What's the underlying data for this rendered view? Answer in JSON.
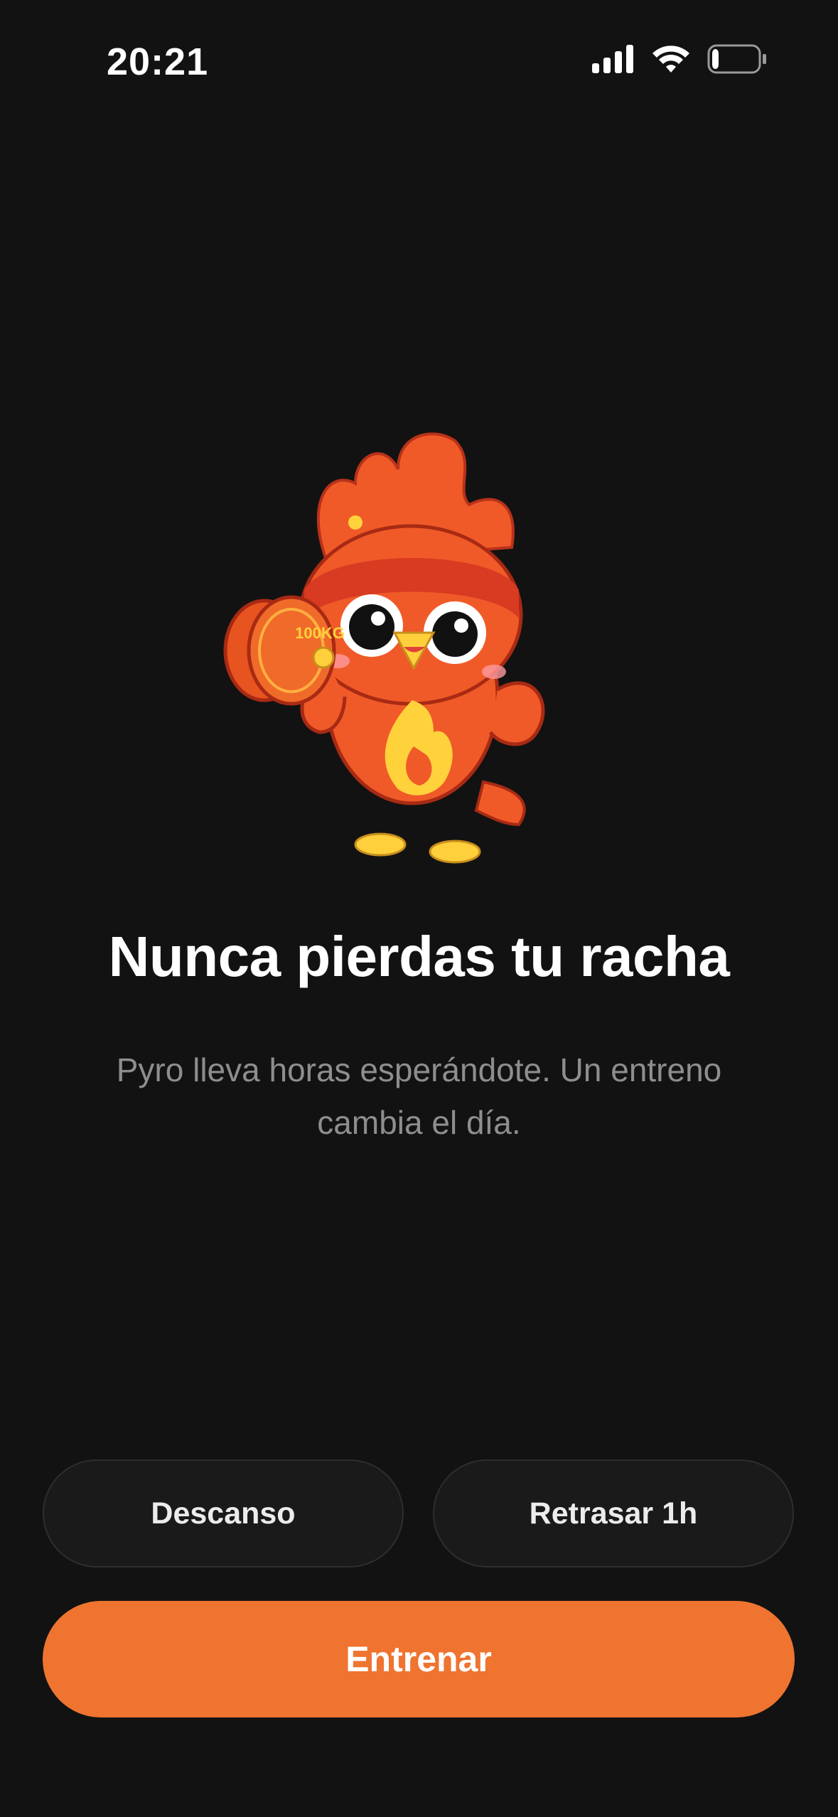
{
  "status_bar": {
    "time": "20:21",
    "icons": [
      "cellular-signal-icon",
      "wifi-icon",
      "battery-icon"
    ],
    "battery_level": 0.15
  },
  "mascot": {
    "name": "Pyro",
    "dumbbell_label": "100KG"
  },
  "content": {
    "title": "Nunca pierdas tu racha",
    "subtitle": "Pyro lleva horas esperándote. Un entreno cambia el día."
  },
  "actions": {
    "rest_label": "Descanso",
    "delay_label": "Retrasar 1h",
    "train_label": "Entrenar"
  },
  "colors": {
    "background": "#121212",
    "accent": "#ee7430",
    "secondary_button": "#1a1a1a",
    "subtitle_text": "#8e8e8e"
  }
}
